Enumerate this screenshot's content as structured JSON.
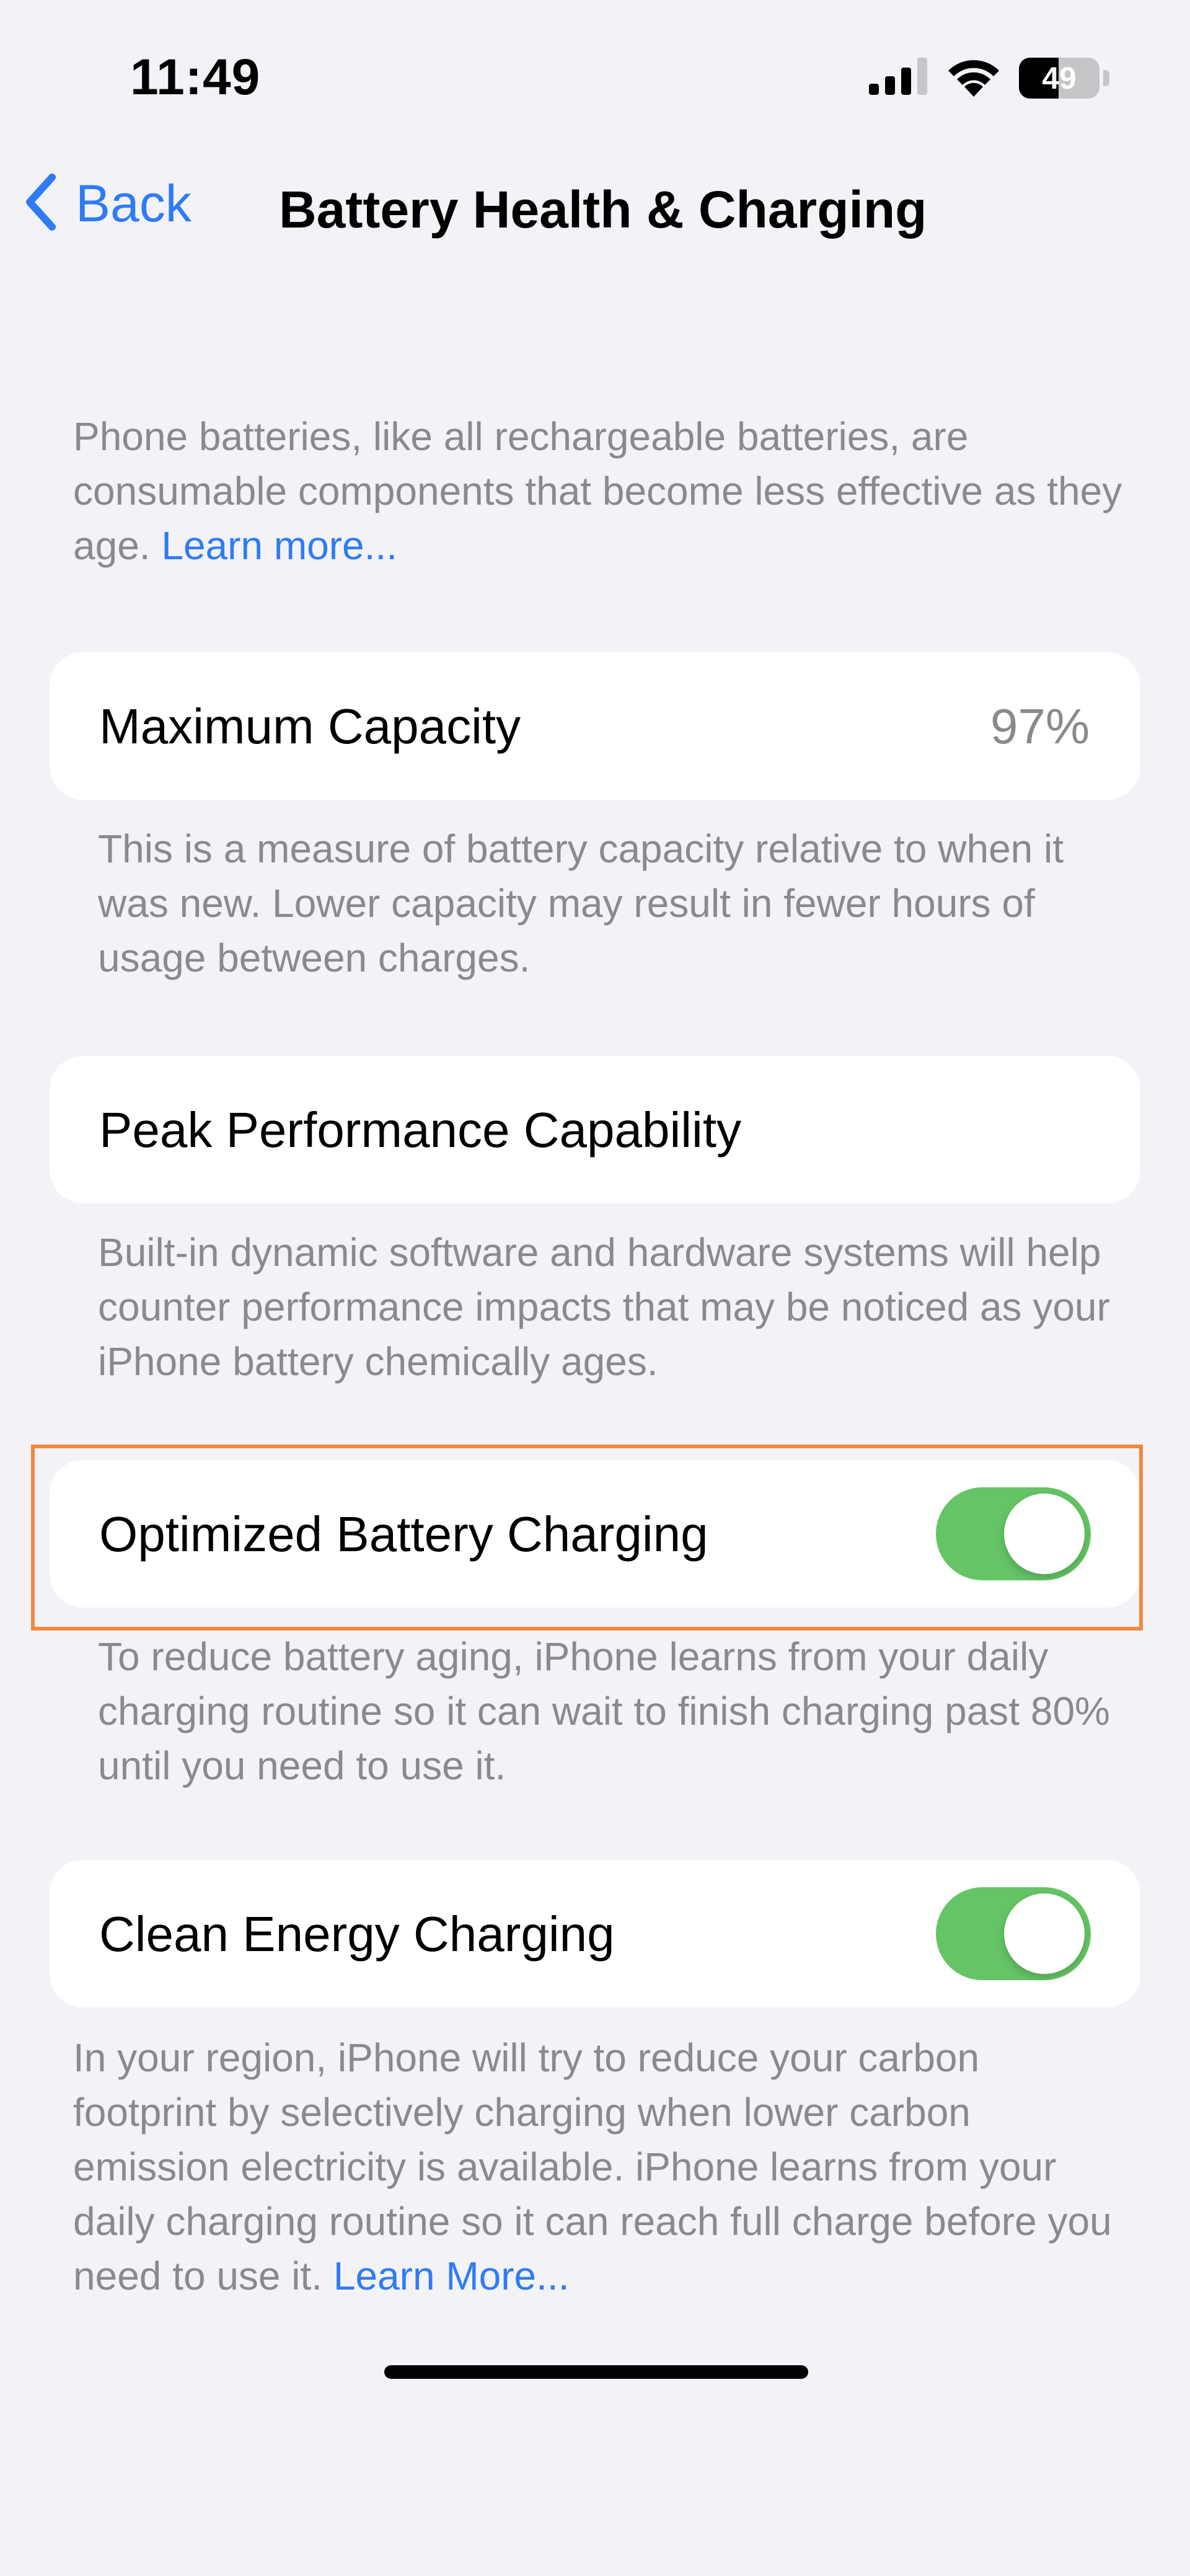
{
  "status_bar": {
    "time": "11:49",
    "battery_level": "49",
    "battery_fraction": 0.49,
    "icons": [
      "cellular-signal-icon",
      "wifi-icon",
      "battery-icon"
    ]
  },
  "nav": {
    "back_label": "Back",
    "title": "Battery Health & Charging"
  },
  "intro": {
    "text": "Phone batteries, like all rechargeable batteries, are consumable components that become less effective as they age. ",
    "link": "Learn more..."
  },
  "maximum_capacity": {
    "label": "Maximum Capacity",
    "value": "97%",
    "footnote": "This is a measure of battery capacity relative to when it was new. Lower capacity may result in fewer hours of usage between charges."
  },
  "peak_performance": {
    "label": "Peak Performance Capability",
    "footnote": "Built-in dynamic software and hardware systems will help counter performance impacts that may be noticed as your iPhone battery chemically ages."
  },
  "optimized_charging": {
    "label": "Optimized Battery Charging",
    "enabled": true,
    "footnote": "To reduce battery aging, iPhone learns from your daily charging routine so it can wait to finish charging past 80% until you need to use it."
  },
  "clean_energy": {
    "label": "Clean Energy Charging",
    "enabled": true,
    "footnote": "In your region, iPhone will try to reduce your carbon footprint by selectively charging when lower carbon emission electricity is available. iPhone learns from your daily charging routine so it can reach full charge before you need to use it. ",
    "link": "Learn More..."
  },
  "colors": {
    "accent": "#2f7bf5",
    "toggle_on": "#65c466",
    "highlight": "#f0883e",
    "background": "#f2f2f7"
  }
}
